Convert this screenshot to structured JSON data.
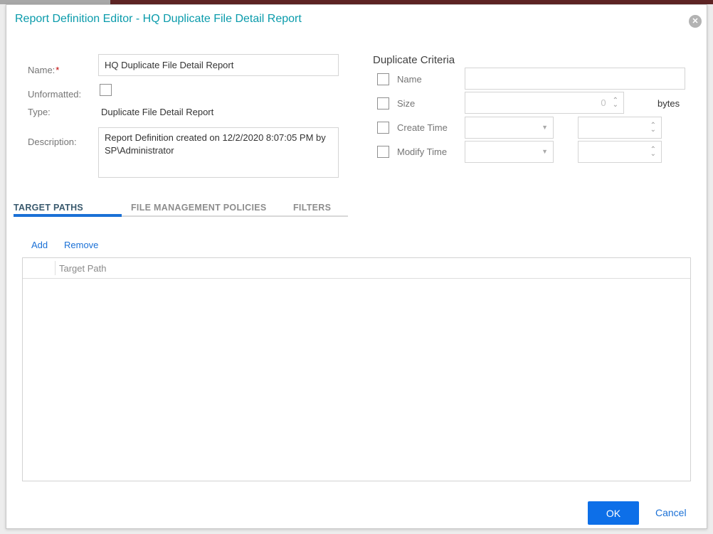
{
  "dialog": {
    "title": "Report Definition Editor - HQ Duplicate File Detail Report",
    "close_glyph": "✕"
  },
  "form": {
    "name_label": "Name:",
    "name_required_mark": "*",
    "name_value": "HQ Duplicate File Detail Report",
    "unformatted_label": "Unformatted:",
    "type_label": "Type:",
    "type_value": "Duplicate File Detail Report",
    "description_label": "Description:",
    "description_value": "Report Definition created on 12/2/2020 8:07:05 PM by SP\\Administrator"
  },
  "criteria": {
    "heading": "Duplicate Criteria",
    "rows": [
      {
        "label": "Name"
      },
      {
        "label": "Size",
        "value": "0",
        "unit": "bytes"
      },
      {
        "label": "Create Time"
      },
      {
        "label": "Modify Time"
      }
    ]
  },
  "tabs": [
    {
      "label": "TARGET PATHS"
    },
    {
      "label": "FILE MANAGEMENT POLICIES"
    },
    {
      "label": "FILTERS"
    }
  ],
  "toolbar": {
    "add_label": "Add",
    "remove_label": "Remove"
  },
  "table": {
    "header": "Target Path"
  },
  "footer": {
    "ok_label": "OK",
    "cancel_label": "Cancel"
  },
  "icons": {
    "spin_up": "⌃",
    "spin_down": "⌄",
    "dropdown": "▼"
  }
}
